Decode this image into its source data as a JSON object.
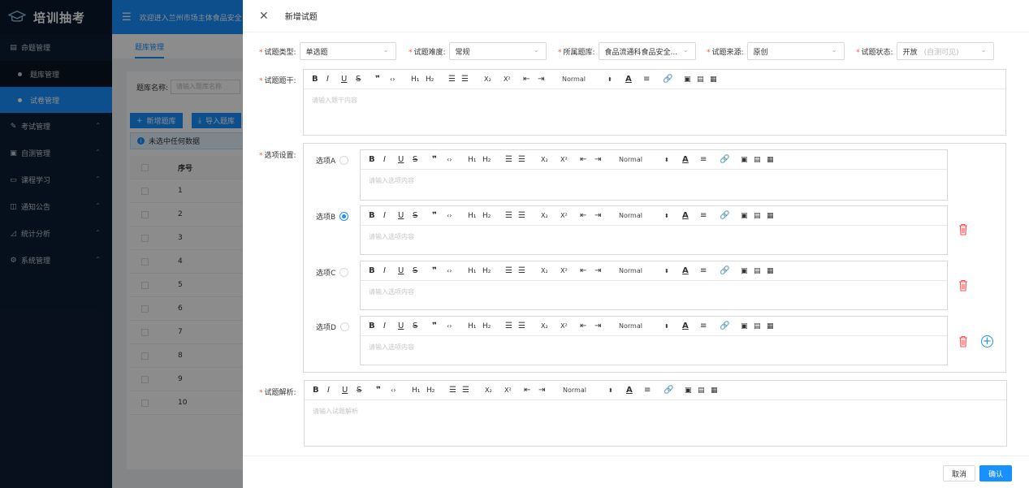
{
  "app": {
    "title": "培训抽考",
    "welcome": "欢迎进入兰州市场主体食品安全"
  },
  "sidebar": {
    "items": [
      {
        "label": "命题管理",
        "icon": "list-icon"
      },
      {
        "label": "题库管理",
        "sub": true
      },
      {
        "label": "试卷管理",
        "sub": true,
        "active": true
      },
      {
        "label": "考试管理",
        "icon": "edit-icon"
      },
      {
        "label": "自测管理",
        "icon": "doc-icon"
      },
      {
        "label": "课程学习",
        "icon": "book-icon"
      },
      {
        "label": "通知公告",
        "icon": "notice-icon"
      },
      {
        "label": "统计分析",
        "icon": "chart-icon"
      },
      {
        "label": "系统管理",
        "icon": "gear-icon"
      }
    ]
  },
  "bg": {
    "tab": "题库管理",
    "search_label": "题库名称:",
    "search_placeholder": "请输入题库名称",
    "add_btn": "新增题库",
    "import_btn": "导入题库",
    "alert": "未选中任何数据",
    "col_index": "序号",
    "rows": [
      "1",
      "2",
      "3",
      "4",
      "5",
      "6",
      "7",
      "8",
      "9",
      "10"
    ]
  },
  "drawer": {
    "title": "新增试题",
    "type_label": "试题类型:",
    "type_value": "单选题",
    "difficulty_label": "试题难度:",
    "difficulty_value": "常规",
    "bank_label": "所属题库:",
    "bank_value": "食品流通科食品安全...",
    "source_label": "试题来源:",
    "source_value": "原创",
    "status_label": "试题状态:",
    "status_value": "开放",
    "status_hint": "(自测可见)",
    "stem_label": "试题题干:",
    "stem_placeholder": "请输入题干内容",
    "options_label": "选项设置:",
    "option_placeholder": "请输入选项内容",
    "options": [
      {
        "label": "选项A",
        "selected": false
      },
      {
        "label": "选项B",
        "selected": true
      },
      {
        "label": "选项C",
        "selected": false
      },
      {
        "label": "选项D",
        "selected": false
      }
    ],
    "analysis_label": "试题解析:",
    "analysis_placeholder": "请输入试题解析",
    "cancel": "取消",
    "confirm": "确认"
  },
  "toolbar": {
    "bold": "B",
    "italic": "I",
    "underline": "U",
    "strike": "S",
    "quote": "❞",
    "code": "‹›",
    "h1": "H₁",
    "h2": "H₂",
    "ol": "☰",
    "ul": "☰",
    "sub": "X₂",
    "sup": "X²",
    "indent_out": "⇤",
    "indent_in": "⇥",
    "size": "Normal",
    "caret": "⬍",
    "color": "A",
    "align": "≡",
    "link": "🔗",
    "image": "▣",
    "video": "▤",
    "table": "▦"
  },
  "colors": {
    "primary": "#1890ff",
    "danger": "#ff4d4f",
    "sidebar": "#0c1e33"
  }
}
